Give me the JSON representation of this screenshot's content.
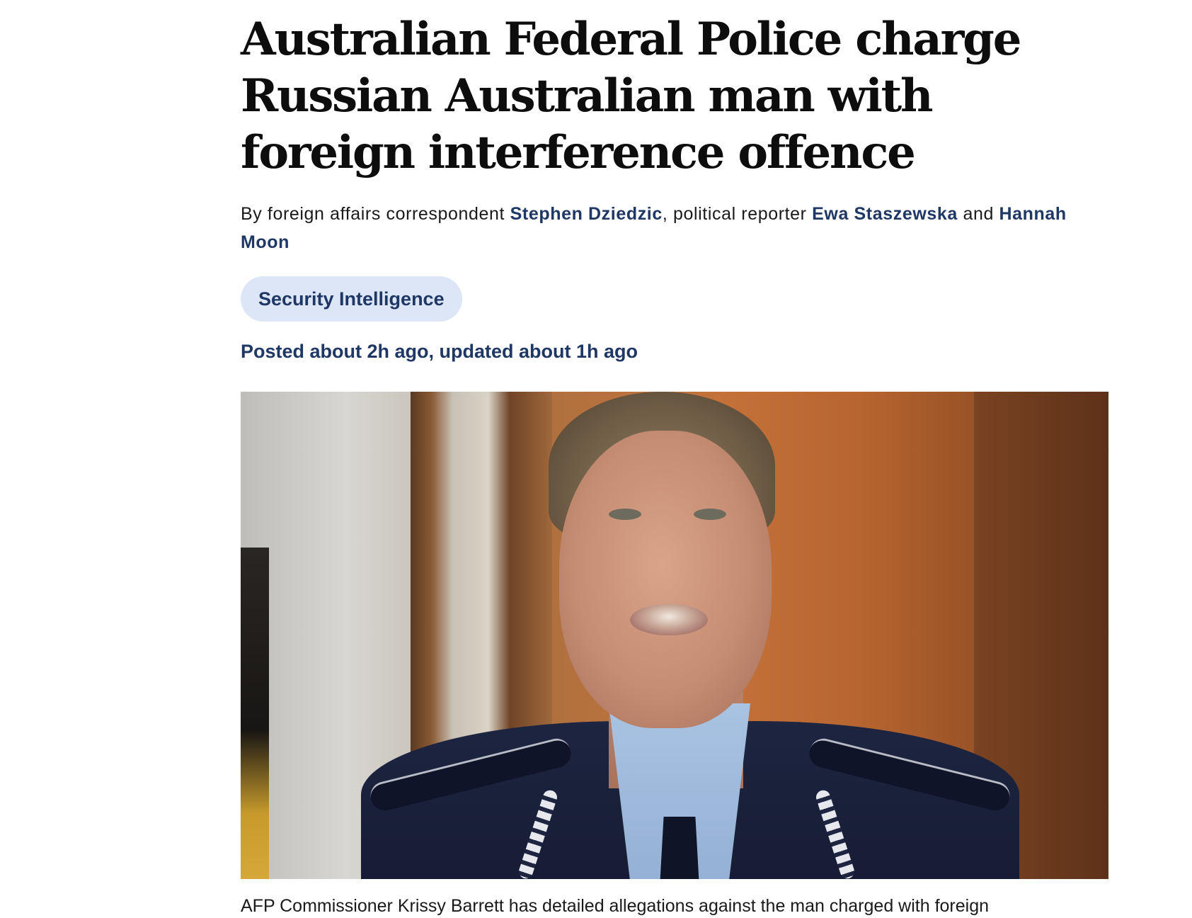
{
  "article": {
    "headline": "Australian Federal Police charge Russian Australian man with foreign interference offence",
    "byline": {
      "prefix": "By foreign affairs correspondent ",
      "author_1": "Stephen Dziedzic",
      "sep_1": ", political reporter ",
      "author_2": "Ewa Staszewska",
      "sep_2": " and ",
      "author_3": "Hannah Moon"
    },
    "topic": "Security Intelligence",
    "timestamp": "Posted about 2h ago, updated about 1h ago",
    "hero_image": {
      "caption": "AFP Commissioner Krissy Barrett has detailed allegations against the man charged with foreign"
    }
  },
  "colors": {
    "link_navy": "#1f3764",
    "pill_background": "#dde6f6",
    "text": "#111111"
  }
}
